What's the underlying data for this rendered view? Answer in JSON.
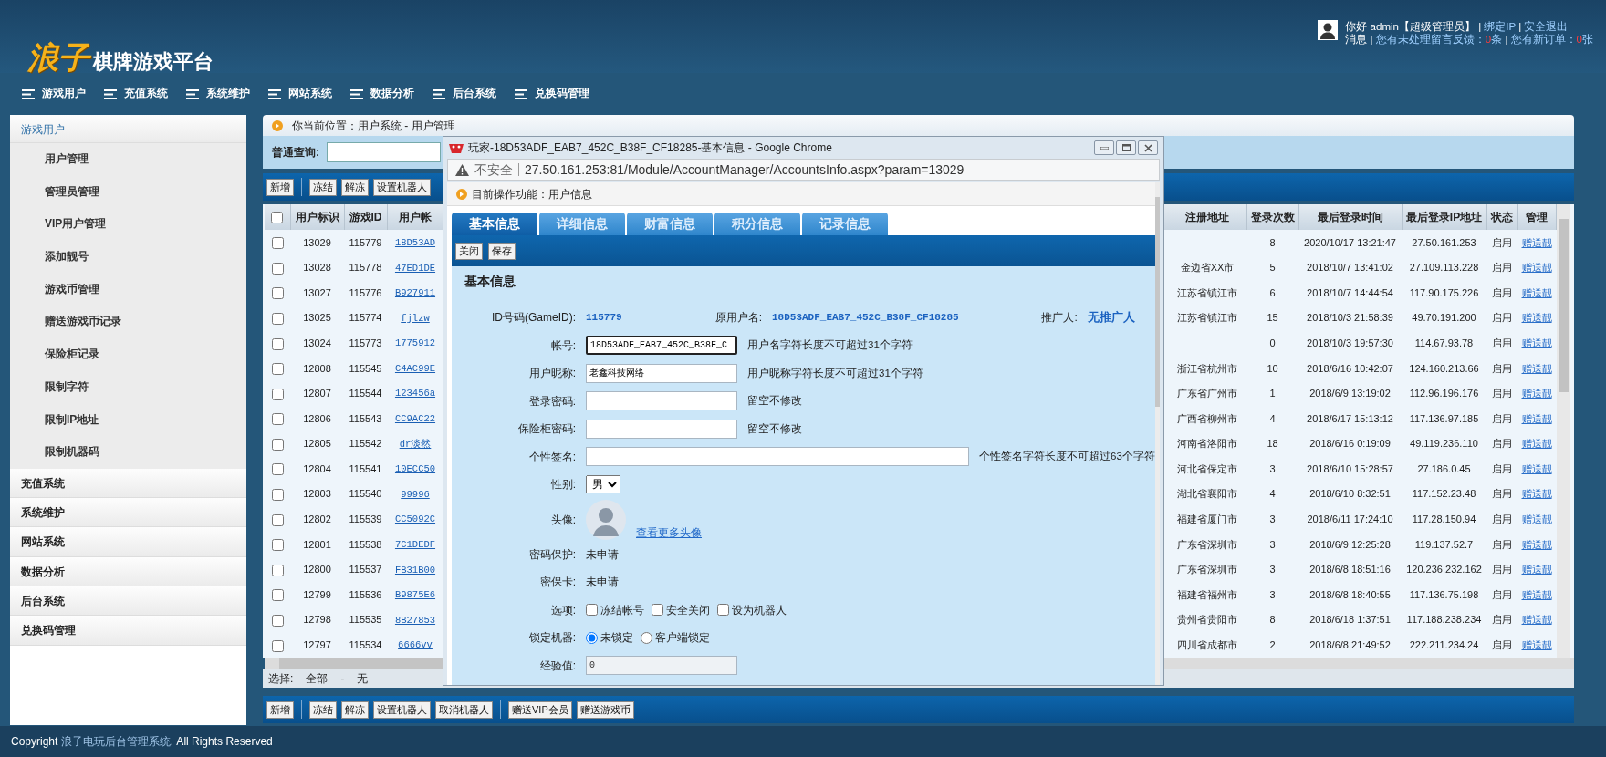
{
  "header": {
    "logo_main": "浪子",
    "logo_sub": "棋牌游戏平台",
    "greeting": "你好 admin【超级管理员】",
    "links": [
      "绑定IP",
      "安全退出"
    ],
    "separator": "|",
    "msg_label": "消息",
    "notices": [
      {
        "text": "您有未处理留言反馈：",
        "count": "0",
        "unit": "条"
      },
      {
        "text": "您有新订单：",
        "count": "0",
        "unit": "张"
      }
    ]
  },
  "nav": [
    "游戏用户",
    "充值系统",
    "系统维护",
    "网站系统",
    "数据分析",
    "后台系统",
    "兑换码管理"
  ],
  "sidebar": {
    "groups": [
      {
        "label": "游戏用户",
        "expanded": true,
        "children": [
          {
            "label": "用户管理"
          },
          {
            "label": "管理员管理"
          },
          {
            "label": "VIP用户管理"
          },
          {
            "label": "添加靓号"
          },
          {
            "label": "游戏币管理"
          },
          {
            "label": "赠送游戏币记录"
          },
          {
            "label": "保险柜记录"
          },
          {
            "label": "限制字符"
          },
          {
            "label": "限制IP地址"
          },
          {
            "label": "限制机器码"
          }
        ]
      },
      {
        "label": "充值系统",
        "expanded": false
      },
      {
        "label": "系统维护",
        "expanded": false
      },
      {
        "label": "网站系统",
        "expanded": false
      },
      {
        "label": "数据分析",
        "expanded": false
      },
      {
        "label": "后台系统",
        "expanded": false
      },
      {
        "label": "兑换码管理",
        "expanded": false
      }
    ]
  },
  "breadcrumb": "你当前位置：用户系统 - 用户管理",
  "search": {
    "label": "普通查询:"
  },
  "top_toolbar": [
    [
      "新增"
    ],
    [
      "冻结",
      "解冻",
      "设置机器人"
    ]
  ],
  "table": {
    "all_checked": false,
    "columns": [
      "用户标识",
      "游戏ID",
      "用户帐",
      "注册地址",
      "登录次数",
      "最后登录时间",
      "最后登录IP地址",
      "状态",
      "管理"
    ],
    "rows": [
      {
        "checked": false,
        "id": "13029",
        "game_id": "115779",
        "account": "18D53AD",
        "logins": "8",
        "last_time": "2020/10/17 13:21:47",
        "last_ip": "27.50.161.253",
        "status": "启用",
        "manage": "赠送靓"
      },
      {
        "checked": false,
        "id": "13028",
        "game_id": "115778",
        "account": "47ED1DE",
        "region": "金边省XX市",
        "logins": "5",
        "last_time": "2018/10/7 13:41:02",
        "last_ip": "27.109.113.228",
        "status": "启用",
        "manage": "赠送靓"
      },
      {
        "checked": false,
        "id": "13027",
        "game_id": "115776",
        "account": "B927911",
        "region": "江苏省镇江市",
        "logins": "6",
        "last_time": "2018/10/7 14:44:54",
        "last_ip": "117.90.175.226",
        "status": "启用",
        "manage": "赠送靓"
      },
      {
        "checked": false,
        "id": "13025",
        "game_id": "115774",
        "account": "fjlzw",
        "region": "江苏省镇江市",
        "logins": "15",
        "last_time": "2018/10/3 21:58:39",
        "last_ip": "49.70.191.200",
        "status": "启用",
        "manage": "赠送靓"
      },
      {
        "checked": false,
        "id": "13024",
        "game_id": "115773",
        "account": "1775912",
        "logins": "0",
        "last_time": "2018/10/3 19:57:30",
        "last_ip": "114.67.93.78",
        "status": "启用",
        "manage": "赠送靓"
      },
      {
        "checked": false,
        "id": "12808",
        "game_id": "115545",
        "account": "C4AC99E",
        "region": "浙江省杭州市",
        "logins": "10",
        "last_time": "2018/6/16 10:42:07",
        "last_ip": "124.160.213.66",
        "status": "启用",
        "manage": "赠送靓"
      },
      {
        "checked": false,
        "id": "12807",
        "game_id": "115544",
        "account": "123456a",
        "region": "广东省广州市",
        "logins": "1",
        "last_time": "2018/6/9 13:19:02",
        "last_ip": "112.96.196.176",
        "status": "启用",
        "manage": "赠送靓"
      },
      {
        "checked": false,
        "id": "12806",
        "game_id": "115543",
        "account": "CC9AC22",
        "region": "广西省柳州市",
        "logins": "4",
        "last_time": "2018/6/17 15:13:12",
        "last_ip": "117.136.97.185",
        "status": "启用",
        "manage": "赠送靓"
      },
      {
        "checked": false,
        "id": "12805",
        "game_id": "115542",
        "account": "dr淡然",
        "region": "河南省洛阳市",
        "logins": "18",
        "last_time": "2018/6/16 0:19:09",
        "last_ip": "49.119.236.110",
        "status": "启用",
        "manage": "赠送靓"
      },
      {
        "checked": false,
        "id": "12804",
        "game_id": "115541",
        "account": "10ECC50",
        "region": "河北省保定市",
        "logins": "3",
        "last_time": "2018/6/10 15:28:57",
        "last_ip": "27.186.0.45",
        "status": "启用",
        "manage": "赠送靓"
      },
      {
        "checked": false,
        "id": "12803",
        "game_id": "115540",
        "account": "99996",
        "region": "湖北省襄阳市",
        "logins": "4",
        "last_time": "2018/6/10 8:32:51",
        "last_ip": "117.152.23.48",
        "status": "启用",
        "manage": "赠送靓"
      },
      {
        "checked": false,
        "id": "12802",
        "game_id": "115539",
        "account": "CC5092C",
        "region": "福建省厦门市",
        "logins": "3",
        "last_time": "2018/6/11 17:24:10",
        "last_ip": "117.28.150.94",
        "status": "启用",
        "manage": "赠送靓"
      },
      {
        "checked": false,
        "id": "12801",
        "game_id": "115538",
        "account": "7C1DEDF",
        "region": "广东省深圳市",
        "logins": "3",
        "last_time": "2018/6/9 12:25:28",
        "last_ip": "119.137.52.7",
        "status": "启用",
        "manage": "赠送靓"
      },
      {
        "checked": false,
        "id": "12800",
        "game_id": "115537",
        "account": "FB31B00",
        "region": "广东省深圳市",
        "logins": "3",
        "last_time": "2018/6/8 18:51:16",
        "last_ip": "120.236.232.162",
        "status": "启用",
        "manage": "赠送靓"
      },
      {
        "checked": false,
        "id": "12799",
        "game_id": "115536",
        "account": "B9875E6",
        "region": "福建省福州市",
        "logins": "3",
        "last_time": "2018/6/8 18:40:55",
        "last_ip": "117.136.75.198",
        "status": "启用",
        "manage": "赠送靓"
      },
      {
        "checked": false,
        "id": "12798",
        "game_id": "115535",
        "account": "8B27853",
        "region": "贵州省贵阳市",
        "logins": "8",
        "last_time": "2018/6/18 1:37:51",
        "last_ip": "117.188.238.234",
        "status": "启用",
        "manage": "赠送靓"
      },
      {
        "checked": false,
        "id": "12797",
        "game_id": "115534",
        "account": "6666vv",
        "region": "四川省成都市",
        "logins": "2",
        "last_time": "2018/6/8 21:49:52",
        "last_ip": "222.211.234.24",
        "status": "启用",
        "manage": "赠送靓"
      }
    ]
  },
  "select_bar": {
    "label": "选择:",
    "all": "全部",
    "dash": "-",
    "none": "无"
  },
  "bottom_toolbar": [
    [
      "新增"
    ],
    [
      "冻结",
      "解冻",
      "设置机器人",
      "取消机器人"
    ],
    [
      "赠送VIP会员",
      "赠送游戏币"
    ]
  ],
  "footer": {
    "prefix": "Copyright",
    "link": "浪子电玩后台管理系统",
    "suffix": ". All Rights Reserved"
  },
  "popup": {
    "title": "玩家-18D53ADF_EAB7_452C_B38F_CF18285-基本信息 - Google Chrome",
    "security": "不安全",
    "url": "27.50.161.253:81/Module/AccountManager/AccountsInfo.aspx?param=13029",
    "function": "目前操作功能：用户信息",
    "tabs": [
      {
        "label": "基本信息",
        "selected": true
      },
      {
        "label": "详细信息",
        "selected": false
      },
      {
        "label": "财富信息",
        "selected": false
      },
      {
        "label": "积分信息",
        "selected": false
      },
      {
        "label": "记录信息",
        "selected": false
      }
    ],
    "actions": [
      "关闭",
      "保存"
    ],
    "form": {
      "title": "基本信息",
      "info": [
        {
          "label": "ID号码(GameID):",
          "value": "115779"
        },
        {
          "label": "原用户名:",
          "value": "18D53ADF_EAB7_452C_B38F_CF18285"
        },
        {
          "label": "推广人:",
          "value": "无推广人"
        }
      ],
      "rows": [
        {
          "kind": "input",
          "label": "帐号:",
          "value": "18D53ADF_EAB7_452C_B38F_C",
          "hint": "用户名字符长度不可超过31个字符",
          "focused": true,
          "disabled": false
        },
        {
          "kind": "input",
          "label": "用户昵称:",
          "value": "老鑫科技网络",
          "hint": "用户昵称字符长度不可超过31个字符",
          "focused": false,
          "disabled": false
        },
        {
          "kind": "input",
          "label": "登录密码:",
          "hint": "留空不修改",
          "focused": false,
          "disabled": false
        },
        {
          "kind": "input",
          "label": "保险柜密码:",
          "hint": "留空不修改",
          "focused": false,
          "disabled": false
        },
        {
          "kind": "wide",
          "label": "个性签名:",
          "hint": "个性签名字符长度不可超过63个字符",
          "focused": false,
          "disabled": false
        },
        {
          "kind": "select",
          "label": "性别:",
          "value": "男"
        },
        {
          "kind": "avatar",
          "label": "头像:",
          "link": "查看更多头像"
        },
        {
          "kind": "text",
          "label": "密码保护:",
          "value": "未申请"
        },
        {
          "kind": "text",
          "label": "密保卡:",
          "value": "未申请"
        },
        {
          "kind": "checks",
          "label": "选项:",
          "options": [
            {
              "label": "冻结帐号",
              "checked": false
            },
            {
              "label": "安全关闭",
              "checked": false
            },
            {
              "label": "设为机器人",
              "checked": false
            }
          ]
        },
        {
          "kind": "radios",
          "label": "锁定机器:",
          "options": [
            {
              "label": "未锁定",
              "selected": true
            },
            {
              "label": "客户端锁定",
              "selected": false
            }
          ]
        },
        {
          "kind": "input",
          "label": "经验值:",
          "value": "0",
          "focused": false,
          "disabled": true
        }
      ]
    }
  }
}
